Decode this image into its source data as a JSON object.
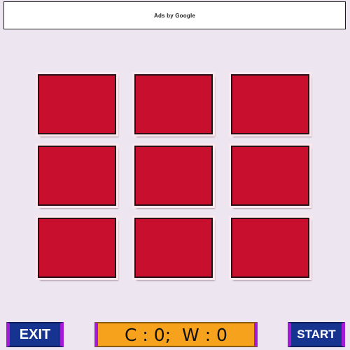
{
  "ad_banner": {
    "label": "Ads by Google"
  },
  "board": {
    "rows": 3,
    "columns": 3,
    "tile_color": "#c8102e"
  },
  "buttons": {
    "exit_label": "EXIT",
    "start_label": "START"
  },
  "score": {
    "text": "C : 0;  W : 0"
  },
  "colors": {
    "background": "#ede6f1",
    "button_blue": "#16348f",
    "button_border_purple": "#a41bd6",
    "score_orange": "#f7a21c"
  }
}
